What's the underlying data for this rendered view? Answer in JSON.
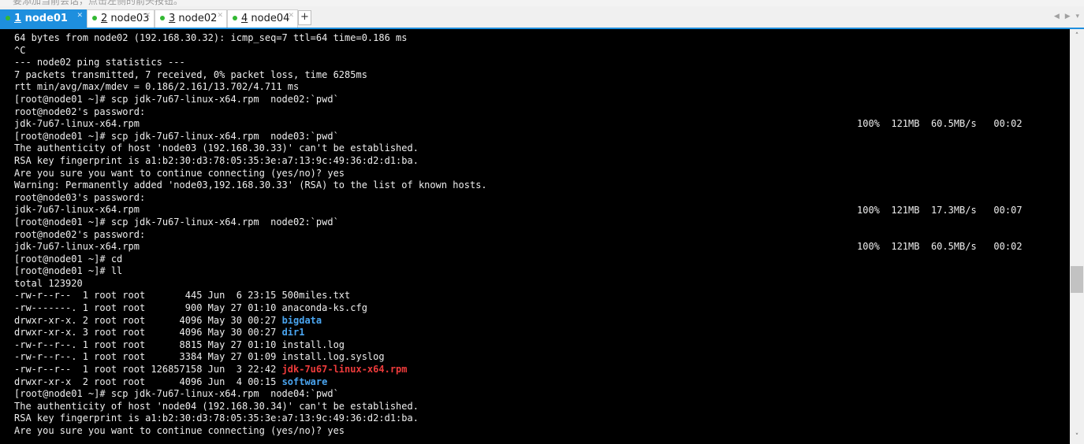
{
  "top_hint": "要添加当前会话，点击左侧的箭头按钮。",
  "tabs": [
    {
      "num": "1",
      "name": "node01",
      "active": true
    },
    {
      "num": "2",
      "name": "node03",
      "active": false
    },
    {
      "num": "3",
      "name": "node02",
      "active": false
    },
    {
      "num": "4",
      "name": "node04",
      "active": false
    }
  ],
  "tab_add_label": "+",
  "tab_nav_label": "◀ ▶ ▾",
  "colors": {
    "accent": "#1e8fde",
    "terminal_bg": "#000000",
    "terminal_fg": "#eeeeee",
    "directory": "#4aa5f0",
    "archive": "#ee3b3b",
    "status_dot": "#33b833"
  },
  "terminal": {
    "lines": [
      "64 bytes from node02 (192.168.30.32): icmp_seq=7 ttl=64 time=0.186 ms",
      "^C",
      "--- node02 ping statistics ---",
      "7 packets transmitted, 7 received, 0% packet loss, time 6285ms",
      "rtt min/avg/max/mdev = 0.186/2.161/13.702/4.711 ms",
      "[root@node01 ~]# scp jdk-7u67-linux-x64.rpm  node02:`pwd`",
      "root@node02's password:",
      "jdk-7u67-linux-x64.rpm",
      "[root@node01 ~]# scp jdk-7u67-linux-x64.rpm  node03:`pwd`",
      "The authenticity of host 'node03 (192.168.30.33)' can't be established.",
      "RSA key fingerprint is a1:b2:30:d3:78:05:35:3e:a7:13:9c:49:36:d2:d1:ba.",
      "Are you sure you want to continue connecting (yes/no)? yes",
      "Warning: Permanently added 'node03,192.168.30.33' (RSA) to the list of known hosts.",
      "root@node03's password:",
      "jdk-7u67-linux-x64.rpm",
      "[root@node01 ~]# scp jdk-7u67-linux-x64.rpm  node02:`pwd`",
      "root@node02's password:",
      "jdk-7u67-linux-x64.rpm",
      "[root@node01 ~]# cd",
      "[root@node01 ~]# ll",
      "total 123920",
      "-rw-r--r--  1 root root       445 Jun  6 23:15 500miles.txt",
      "-rw-------. 1 root root       900 May 27 01:10 anaconda-ks.cfg",
      "drwxr-xr-x. 2 root root      4096 May 30 00:27 ",
      "drwxr-xr-x. 3 root root      4096 May 30 00:27 ",
      "-rw-r--r--. 1 root root      8815 May 27 01:10 install.log",
      "-rw-r--r--. 1 root root      3384 May 27 01:09 install.log.syslog",
      "-rw-r--r--  1 root root 126857158 Jun  3 22:42 ",
      "drwxr-xr-x  2 root root      4096 Jun  4 00:15 ",
      "[root@node01 ~]# scp jdk-7u67-linux-x64.rpm  node04:`pwd`",
      "The authenticity of host 'node04 (192.168.30.34)' can't be established.",
      "RSA key fingerprint is a1:b2:30:d3:78:05:35:3e:a7:13:9c:49:36:d2:d1:ba.",
      "Are you sure you want to continue connecting (yes/no)? yes"
    ],
    "highlights": {
      "line_23": "bigdata",
      "line_24": "dir1",
      "line_27": "jdk-7u67-linux-x64.rpm",
      "line_28": "software"
    },
    "transfers": [
      {
        "percent": "100%",
        "size": "121MB",
        "speed": "60.5MB/s",
        "time": "00:02"
      },
      {
        "percent": "100%",
        "size": "121MB",
        "speed": "17.3MB/s",
        "time": "00:07"
      },
      {
        "percent": "100%",
        "size": "121MB",
        "speed": "60.5MB/s",
        "time": "00:02"
      }
    ]
  },
  "scrollbar": {
    "up_icon": "˄",
    "down_icon": "˅"
  }
}
